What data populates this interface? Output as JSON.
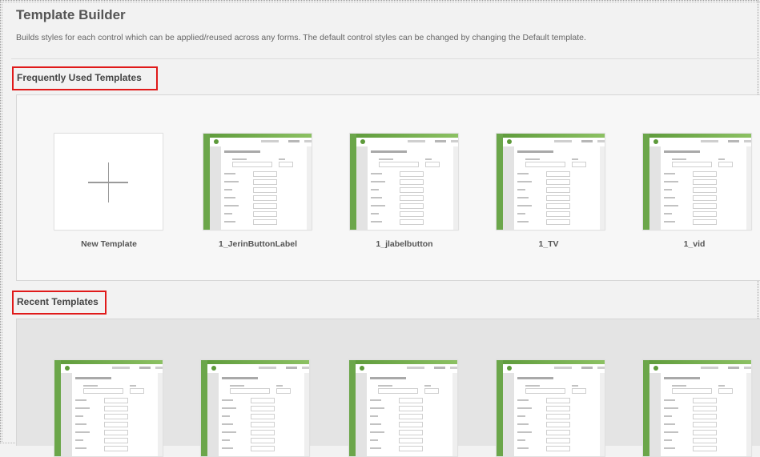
{
  "page": {
    "title": "Template Builder",
    "description": "Builds styles for each control which can be applied/reused across any forms. The default control styles can be changed by changing the Default template."
  },
  "sections": {
    "frequent": {
      "heading": "Frequently Used Templates",
      "new_template_label": "New Template",
      "templates": [
        {
          "label": "1_JerinButtonLabel"
        },
        {
          "label": "1_jlabelbutton"
        },
        {
          "label": "1_TV"
        },
        {
          "label": "1_vid"
        }
      ]
    },
    "recent": {
      "heading": "Recent Templates"
    }
  },
  "colors": {
    "highlight_box": "#e01a1a",
    "thumbnail_accent": "#6ba64a",
    "recent_panel_bg": "#e4e4e4"
  },
  "icons": {
    "new_template": "plus-icon"
  }
}
